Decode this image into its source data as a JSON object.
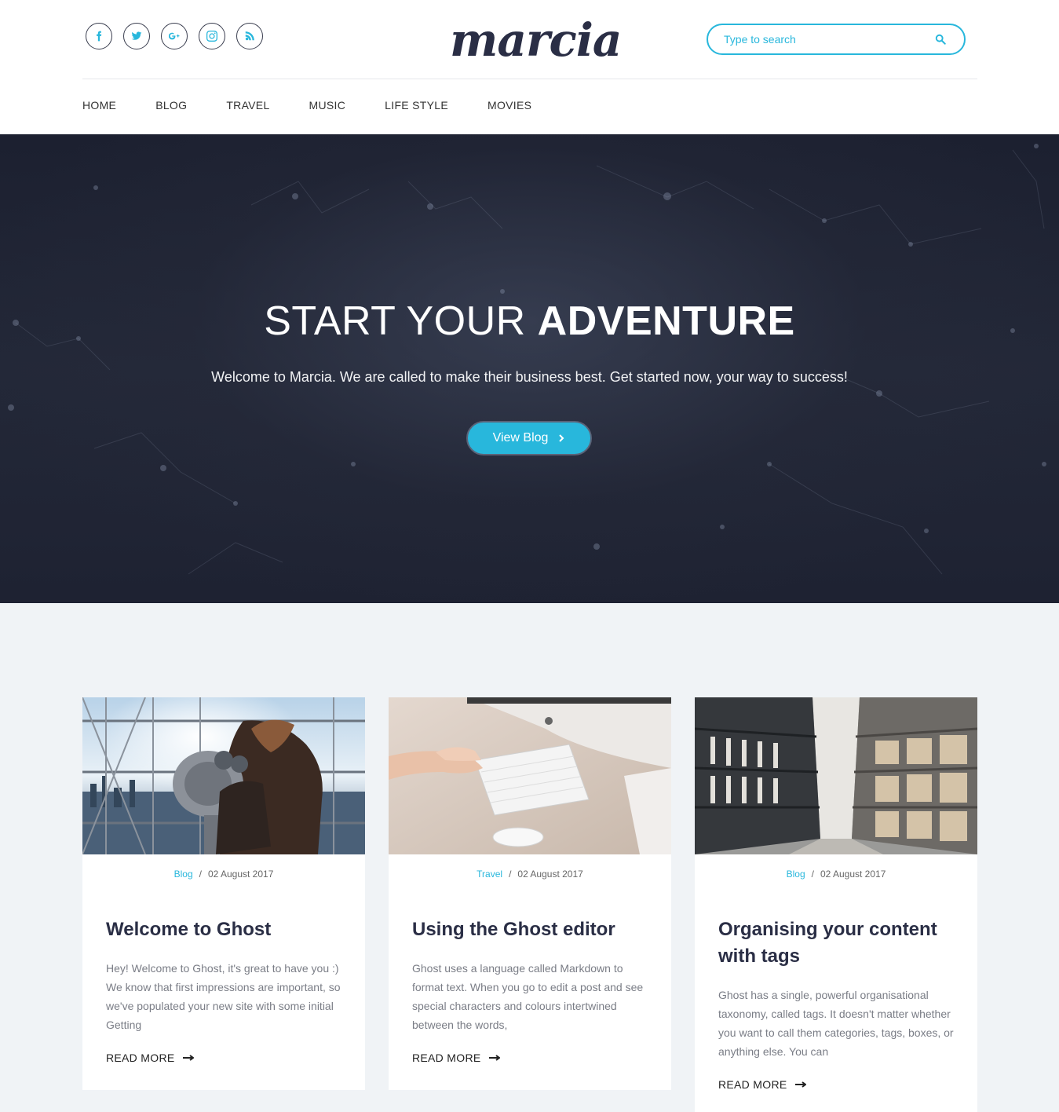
{
  "header": {
    "logo": "marcia",
    "socials": [
      {
        "icon": "facebook-icon"
      },
      {
        "icon": "twitter-icon"
      },
      {
        "icon": "google-plus-icon"
      },
      {
        "icon": "instagram-icon"
      },
      {
        "icon": "rss-icon"
      }
    ],
    "search": {
      "placeholder": "Type to search",
      "icon": "search-icon"
    },
    "nav": [
      "HOME",
      "BLOG",
      "TRAVEL",
      "MUSIC",
      "LIFE STYLE",
      "MOVIES"
    ]
  },
  "hero": {
    "title_light": "START YOUR ",
    "title_bold": "ADVENTURE",
    "subtitle": "Welcome to Marcia. We are called to make their business best. Get started now, your way to success!",
    "button_label": "View Blog",
    "button_icon": "chevron-right-icon"
  },
  "posts": [
    {
      "tag": "Blog",
      "date": "02 August 2017",
      "title": "Welcome to Ghost",
      "excerpt": "Hey! Welcome to Ghost, it's great to have you :) We know that first impressions are important, so we've populated your new site with some initial Getting",
      "read_more": "READ MORE"
    },
    {
      "tag": "Travel",
      "date": "02 August 2017",
      "title": "Using the Ghost editor",
      "excerpt": "Ghost uses a language called Markdown to format text. When you go to edit a post and see special characters and colours intertwined between the words,",
      "read_more": "READ MORE"
    },
    {
      "tag": "Blog",
      "date": "02 August 2017",
      "title": "Organising your content with tags",
      "excerpt": "Ghost has a single, powerful organisational taxonomy, called tags. It doesn't matter whether you want to call them categories, tags, boxes, or anything else. You can",
      "read_more": "READ MORE"
    }
  ],
  "colors": {
    "accent": "#28b7dc",
    "dark": "#2a2e45",
    "hero_bg": "#1e2232",
    "page_bg": "#f0f3f6"
  }
}
